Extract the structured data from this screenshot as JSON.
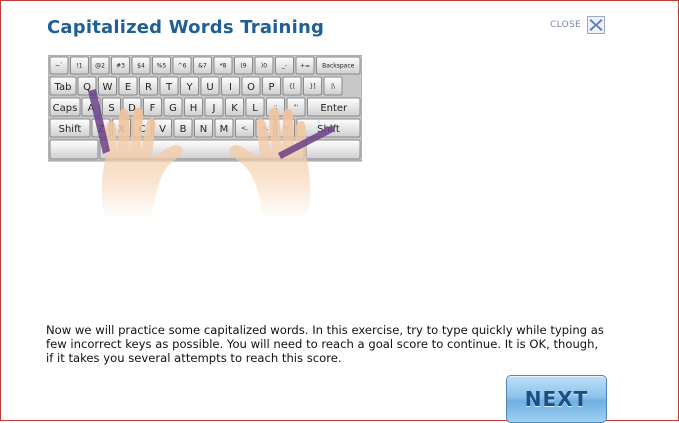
{
  "header": {
    "title": "Capitalized Words Training",
    "close_label": "CLOSE"
  },
  "keyboard": {
    "number_row": [
      "~`",
      "!1",
      "@2",
      "#3",
      "$4",
      "%5",
      "^6",
      "&7",
      "*8",
      "(9",
      ")0",
      "_-",
      "+="
    ],
    "backspace": "Backspace",
    "tab": "Tab",
    "top_row": [
      "Q",
      "W",
      "E",
      "R",
      "T",
      "Y",
      "U",
      "I",
      "O",
      "P",
      "{[",
      "}]",
      "|\\"
    ],
    "caps": "Caps",
    "home_row": [
      "A",
      "S",
      "D",
      "F",
      "G",
      "H",
      "J",
      "K",
      "L",
      ":;",
      "\"'"
    ],
    "enter": "Enter",
    "shift_left": "Shift",
    "bottom_row": [
      "Z",
      "X",
      "C",
      "V",
      "B",
      "N",
      "M",
      "<,",
      ">.",
      "?/"
    ],
    "shift_right": "Shift",
    "highlighted_keys": [
      "Q",
      "A",
      "Z",
      "Shift",
      "Shift"
    ]
  },
  "body": {
    "description": "Now we will practice some capitalized words. In this exercise, try to type quickly while typing as few incorrect keys as possible. You will need to reach a goal score to continue. It is OK, though, if it takes you several attempts to reach this score."
  },
  "footer": {
    "next_label": "NEXT"
  },
  "colors": {
    "title": "#1f5f95",
    "border": "#c23b3b",
    "finger_highlight": "#6a3f86",
    "hand": "#f2c49b"
  }
}
